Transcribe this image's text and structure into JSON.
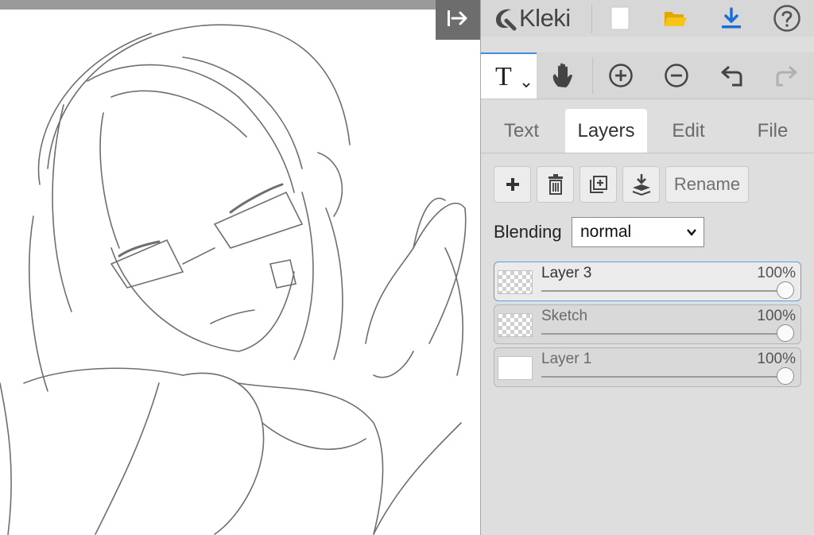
{
  "app": {
    "name": "Kleki"
  },
  "canvas": {
    "collapse_icon": "arrow-right-bar-icon"
  },
  "toolbar_top": {
    "icons": [
      "new-image-icon",
      "open-folder-icon",
      "download-icon",
      "help-icon"
    ],
    "colors": {
      "folder": "#f5c518",
      "download": "#1a6fd6"
    }
  },
  "toolbar_tools": {
    "active_tool_label": "T",
    "icons": [
      "text-tool-icon",
      "hand-tool-icon",
      "zoom-in-icon",
      "zoom-out-icon",
      "undo-icon",
      "redo-icon"
    ]
  },
  "tabs": [
    {
      "label": "Text",
      "active": false
    },
    {
      "label": "Layers",
      "active": true
    },
    {
      "label": "Edit",
      "active": false
    },
    {
      "label": "File",
      "active": false
    }
  ],
  "layer_actions": {
    "rename_label": "Rename"
  },
  "blending": {
    "label": "Blending",
    "value": "normal"
  },
  "layers": [
    {
      "name": "Layer 3",
      "opacity": "100%",
      "active": true
    },
    {
      "name": "Sketch",
      "opacity": "100%",
      "active": false
    },
    {
      "name": "Layer 1",
      "opacity": "100%",
      "active": false
    }
  ],
  "accent_color": "#3f8de0"
}
